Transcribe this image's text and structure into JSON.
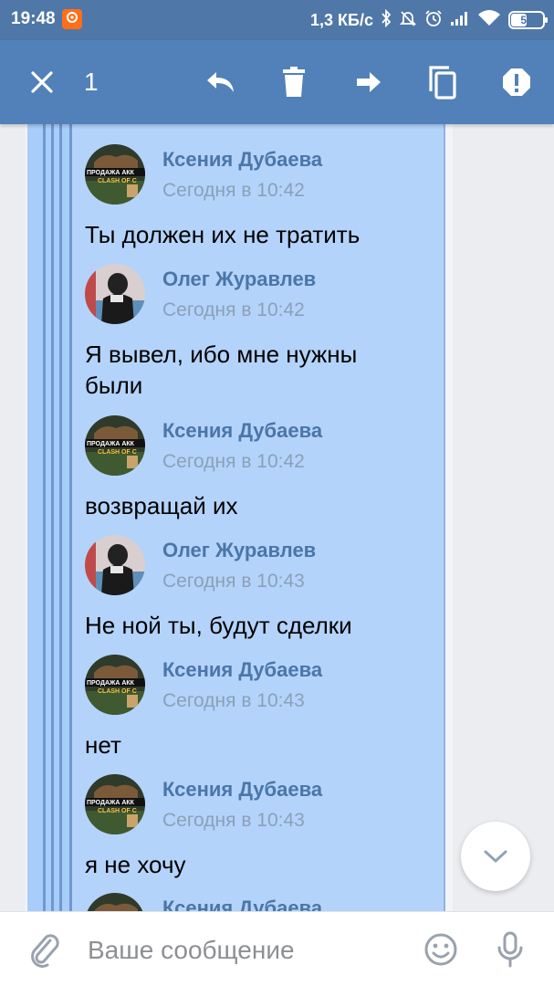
{
  "status_bar": {
    "time": "19:48",
    "net_speed": "1,3 КБ/с",
    "battery_level": "51",
    "battery_fraction": 0.51,
    "icons": [
      "notification-icon",
      "bluetooth-icon",
      "alarm-off-icon",
      "alarm-clock-icon",
      "signal-icon",
      "wifi-icon",
      "battery-icon"
    ]
  },
  "toolbar": {
    "selected_count": "1",
    "actions": [
      "close-icon",
      "reply-icon",
      "delete-icon",
      "forward-icon",
      "copy-icon",
      "report-icon"
    ]
  },
  "messages": [
    {
      "author": "Ксения Дубаева",
      "time": "Сегодня в 10:42",
      "text": "Ты должен их не тратить",
      "avatar": "clash"
    },
    {
      "author": "Олег Журавлев",
      "time": "Сегодня в 10:42",
      "text": "Я вывел, ибо мне нужны были",
      "avatar": "person"
    },
    {
      "author": "Ксения Дубаева",
      "time": "Сегодня в 10:42",
      "text": "возвращай их",
      "avatar": "clash"
    },
    {
      "author": "Олег Журавлев",
      "time": "Сегодня в 10:43",
      "text": "Не ной ты, будут сделки",
      "avatar": "person"
    },
    {
      "author": "Ксения Дубаева",
      "time": "Сегодня в 10:43",
      "text": "нет",
      "avatar": "clash"
    },
    {
      "author": "Ксения Дубаева",
      "time": "Сегодня в 10:43",
      "text": "я не хочу",
      "avatar": "clash"
    },
    {
      "author": "Ксения Дубаева",
      "time": "",
      "text": "",
      "avatar": "clash"
    }
  ],
  "avatar_text": {
    "line1": "ПРОДАЖА АКК",
    "line2": "CLASH OF C"
  },
  "composer": {
    "placeholder": "Ваше сообщение"
  },
  "colors": {
    "header": "#5181b8",
    "selection": "#a9cdfa",
    "author": "#4a76a8"
  }
}
